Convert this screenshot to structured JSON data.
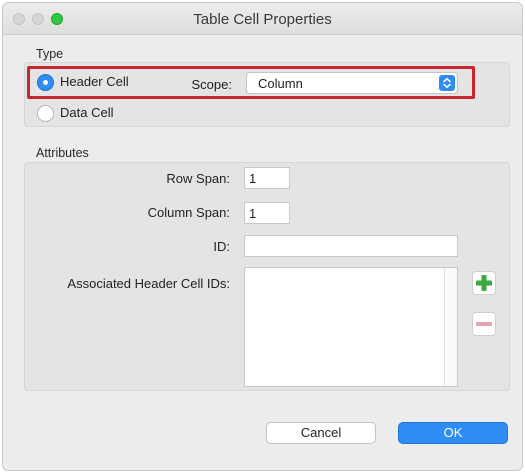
{
  "window": {
    "title": "Table Cell Properties"
  },
  "type_section": {
    "label": "Type",
    "header_cell_label": "Header Cell",
    "header_cell_selected": true,
    "data_cell_label": "Data Cell",
    "data_cell_selected": false,
    "scope_label": "Scope:",
    "scope_value": "Column"
  },
  "attributes_section": {
    "label": "Attributes",
    "row_span_label": "Row Span:",
    "row_span_value": "1",
    "column_span_label": "Column Span:",
    "column_span_value": "1",
    "id_label": "ID:",
    "id_value": "",
    "assoc_label": "Associated Header Cell IDs:"
  },
  "buttons": {
    "cancel": "Cancel",
    "ok": "OK"
  },
  "colors": {
    "accent": "#2f8cf5",
    "highlight_border": "#c8262c",
    "add_green": "#3aa83a",
    "remove_pink": "#e8a3b0"
  },
  "icons": {
    "add": "plus-icon",
    "remove": "minus-icon",
    "select_arrows": "chevron-updown-icon"
  }
}
